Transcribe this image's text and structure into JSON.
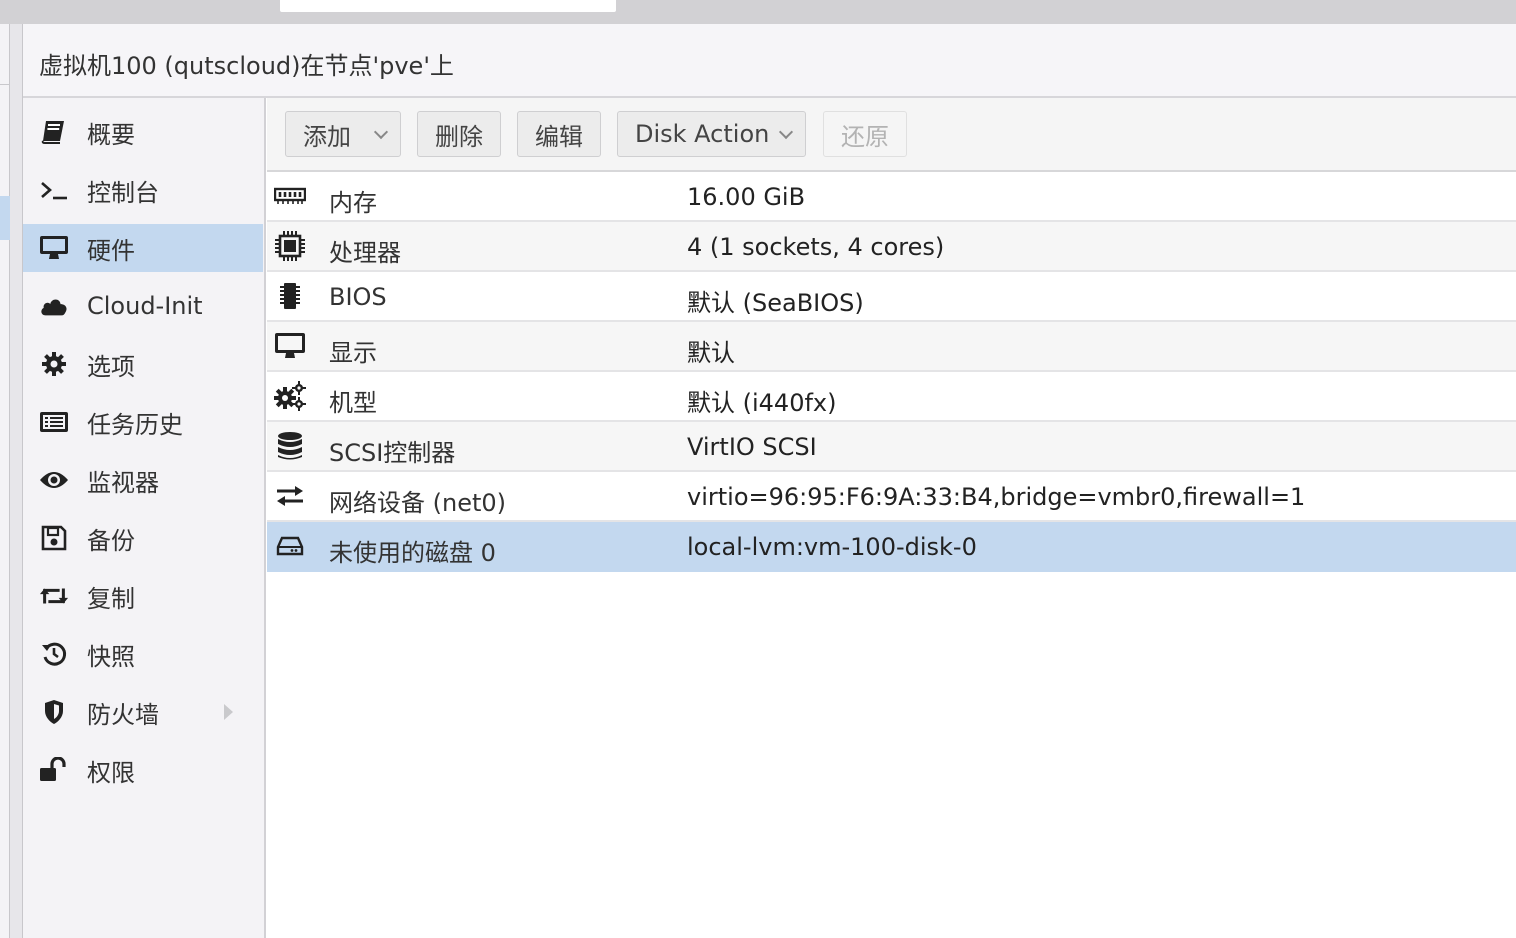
{
  "panel": {
    "title": "虚拟机100 (qutscloud)在节点'pve'上"
  },
  "sidebar": {
    "items": [
      {
        "label": "概要",
        "icon": "book-icon"
      },
      {
        "label": "控制台",
        "icon": "terminal-icon"
      },
      {
        "label": "硬件",
        "icon": "desktop-icon",
        "selected": true
      },
      {
        "label": "Cloud-Init",
        "icon": "cloud-icon"
      },
      {
        "label": "选项",
        "icon": "gear-icon"
      },
      {
        "label": "任务历史",
        "icon": "list-icon"
      },
      {
        "label": "监视器",
        "icon": "eye-icon"
      },
      {
        "label": "备份",
        "icon": "floppy-disk-icon"
      },
      {
        "label": "复制",
        "icon": "retweet-icon"
      },
      {
        "label": "快照",
        "icon": "history-icon"
      },
      {
        "label": "防火墙",
        "icon": "shield-icon",
        "expandable": true
      },
      {
        "label": "权限",
        "icon": "unlock-icon"
      }
    ]
  },
  "toolbar": {
    "add_label": "添加",
    "delete_label": "删除",
    "edit_label": "编辑",
    "disk_action_label": "Disk Action",
    "revert_label": "还原"
  },
  "hardware": {
    "rows": [
      {
        "name": "内存",
        "value": "16.00 GiB",
        "icon": "memory-icon"
      },
      {
        "name": "处理器",
        "value": "4 (1 sockets, 4 cores)",
        "icon": "cpu-icon"
      },
      {
        "name": "BIOS",
        "value": "默认 (SeaBIOS)",
        "icon": "microchip-icon"
      },
      {
        "name": "显示",
        "value": "默认",
        "icon": "desktop-icon"
      },
      {
        "name": "机型",
        "value": "默认 (i440fx)",
        "icon": "gears-icon"
      },
      {
        "name": "SCSI控制器",
        "value": "VirtIO SCSI",
        "icon": "database-icon"
      },
      {
        "name": "网络设备 (net0)",
        "value": "virtio=96:95:F6:9A:33:B4,bridge=vmbr0,firewall=1",
        "icon": "exchange-icon"
      },
      {
        "name": "未使用的磁盘 0",
        "value": "local-lvm:vm-100-disk-0",
        "icon": "hdd-icon",
        "selected": true
      }
    ]
  },
  "colors": {
    "selection": "#c3d8ef",
    "sidebar_bg": "#f4f3f6",
    "toolbar_bg": "#f5f5f5"
  }
}
